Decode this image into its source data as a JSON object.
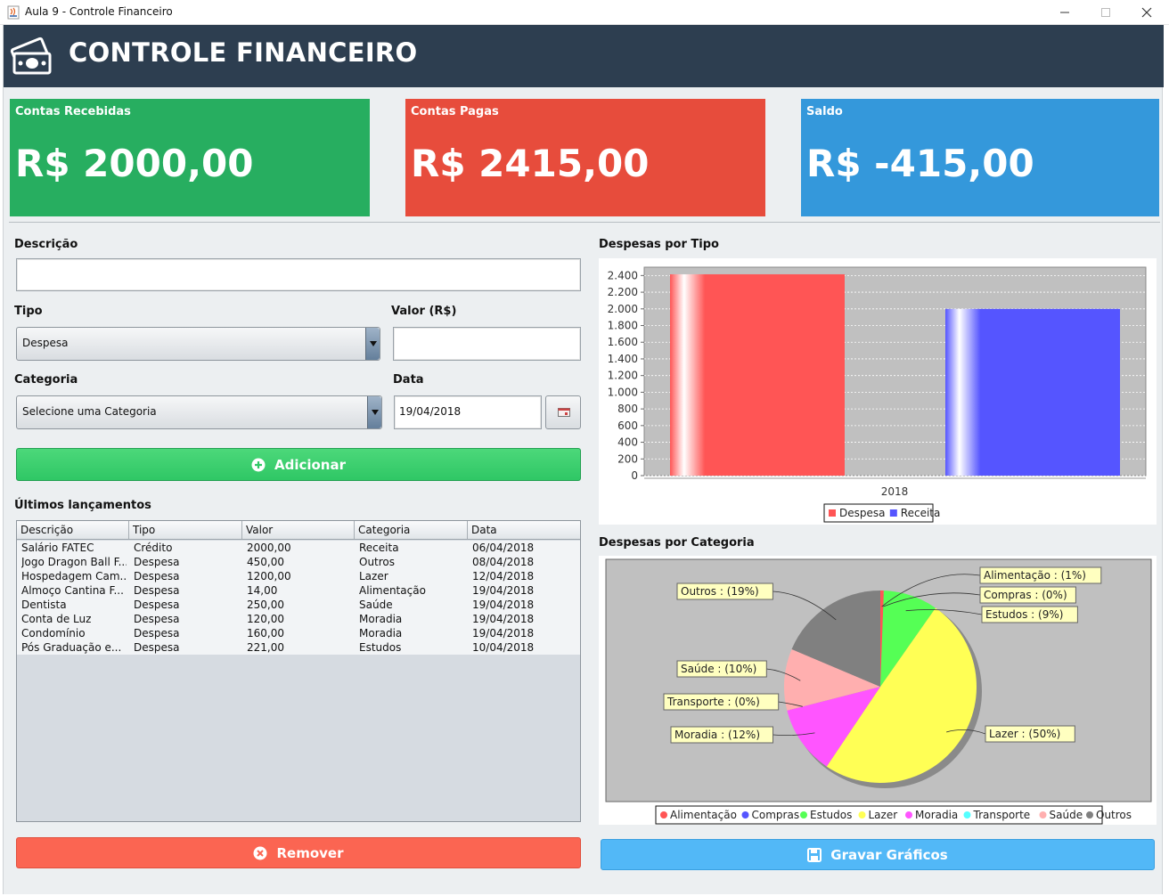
{
  "window": {
    "title": "Aula 9 - Controle Financeiro"
  },
  "header": {
    "title": "CONTROLE FINANCEIRO",
    "logo_icon": "money-icon"
  },
  "cards": {
    "received": {
      "label": "Contas Recebidas",
      "value": "R$ 2000,00",
      "color": "#27ae60"
    },
    "paid": {
      "label": "Contas Pagas",
      "value": "R$ 2415,00",
      "color": "#e74c3c"
    },
    "balance": {
      "label": "Saldo",
      "value": "R$ -415,00",
      "color": "#3498db"
    }
  },
  "form": {
    "description_label": "Descrição",
    "description_value": "",
    "type_label": "Tipo",
    "type_value": "Despesa",
    "amount_label": "Valor (R$)",
    "amount_value": "",
    "category_label": "Categoria",
    "category_value": "Selecione uma Categoria",
    "date_label": "Data",
    "date_value": "19/04/2018",
    "add_label": "Adicionar"
  },
  "entries": {
    "title": "Últimos lançamentos",
    "columns": [
      "Descrição",
      "Tipo",
      "Valor",
      "Categoria",
      "Data"
    ],
    "rows": [
      [
        "Salário FATEC",
        "Crédito",
        "2000,00",
        "Receita",
        "06/04/2018"
      ],
      [
        "Jogo Dragon Ball F...",
        "Despesa",
        "450,00",
        "Outros",
        "08/04/2018"
      ],
      [
        "Hospedagem Cam...",
        "Despesa",
        "1200,00",
        "Lazer",
        "12/04/2018"
      ],
      [
        "Almoço Cantina F...",
        "Despesa",
        "14,00",
        "Alimentação",
        "19/04/2018"
      ],
      [
        "Dentista",
        "Despesa",
        "250,00",
        "Saúde",
        "19/04/2018"
      ],
      [
        "Conta de Luz",
        "Despesa",
        "120,00",
        "Moradia",
        "19/04/2018"
      ],
      [
        "Condomínio",
        "Despesa",
        "160,00",
        "Moradia",
        "19/04/2018"
      ],
      [
        "Pós Graduação e...",
        "Despesa",
        "221,00",
        "Estudos",
        "10/04/2018"
      ]
    ]
  },
  "buttons": {
    "remove_label": "Remover",
    "save_charts_label": "Gravar Gráficos"
  },
  "chart_data": [
    {
      "type": "bar",
      "title": "Despesas por Tipo",
      "categories": [
        "2018"
      ],
      "series": [
        {
          "name": "Despesa",
          "values": [
            2415
          ],
          "color": "#ff5555"
        },
        {
          "name": "Receita",
          "values": [
            2000
          ],
          "color": "#5555ff"
        }
      ],
      "ylim": [
        0,
        2500
      ],
      "yticks": [
        "0",
        "200",
        "400",
        "600",
        "800",
        "1.000",
        "1.200",
        "1.400",
        "1.600",
        "1.800",
        "2.000",
        "2.200",
        "2.400"
      ],
      "grid": true,
      "legend": "bottom"
    },
    {
      "type": "pie",
      "title": "Despesas por Categoria",
      "slices": [
        {
          "name": "Alimentação",
          "value": 14,
          "label": "Alimentação : (1%)",
          "color": "#ff5555"
        },
        {
          "name": "Compras",
          "value": 0,
          "label": "Compras : (0%)",
          "color": "#5555ff"
        },
        {
          "name": "Estudos",
          "value": 221,
          "label": "Estudos : (9%)",
          "color": "#55ff55"
        },
        {
          "name": "Lazer",
          "value": 1200,
          "label": "Lazer : (50%)",
          "color": "#ffff55"
        },
        {
          "name": "Moradia",
          "value": 280,
          "label": "Moradia : (12%)",
          "color": "#ff55ff"
        },
        {
          "name": "Transporte",
          "value": 0,
          "label": "Transporte : (0%)",
          "color": "#55ffff"
        },
        {
          "name": "Saúde",
          "value": 250,
          "label": "Saúde : (10%)",
          "color": "#ffafaf"
        },
        {
          "name": "Outros",
          "value": 450,
          "label": "Outros : (19%)",
          "color": "#808080"
        }
      ],
      "legend": "bottom"
    }
  ]
}
